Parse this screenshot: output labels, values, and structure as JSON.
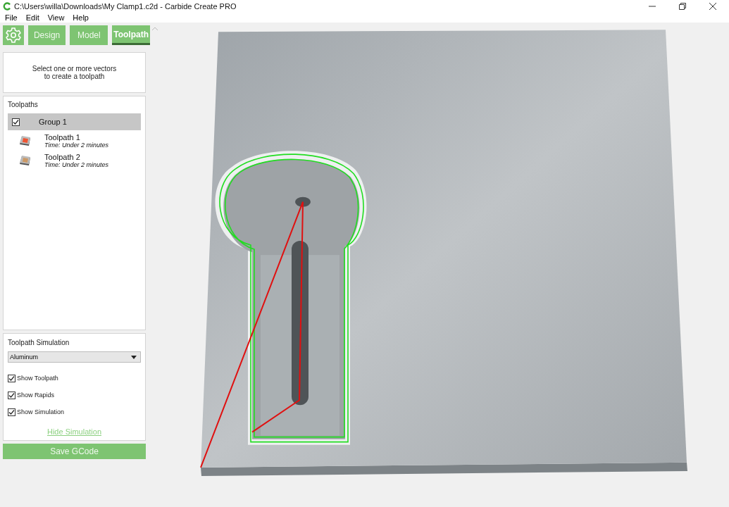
{
  "window": {
    "title": "C:\\Users\\willa\\Downloads\\My Clamp1.c2d - Carbide Create PRO"
  },
  "menu": [
    "File",
    "Edit",
    "View",
    "Help"
  ],
  "tabs": [
    {
      "label": "Design",
      "selected": false
    },
    {
      "label": "Model",
      "selected": false
    },
    {
      "label": "Toolpath",
      "selected": true
    }
  ],
  "hint": "Select one or more vectors\nto create a toolpath",
  "toolpaths": {
    "title": "Toolpaths",
    "group": {
      "label": "Group 1",
      "checked": true,
      "selected": true
    },
    "items": [
      {
        "name": "Toolpath 1",
        "time": "Time: Under 2 minutes"
      },
      {
        "name": "Toolpath 2",
        "time": "Time: Under 2 minutes"
      }
    ]
  },
  "simulation": {
    "title": "Toolpath Simulation",
    "material": "Aluminum",
    "options": [
      {
        "label": "Show Toolpath",
        "checked": true
      },
      {
        "label": "Show Rapids",
        "checked": true
      },
      {
        "label": "Show Simulation",
        "checked": true
      }
    ],
    "link": "Hide Simulation"
  },
  "save_button": "Save GCode"
}
